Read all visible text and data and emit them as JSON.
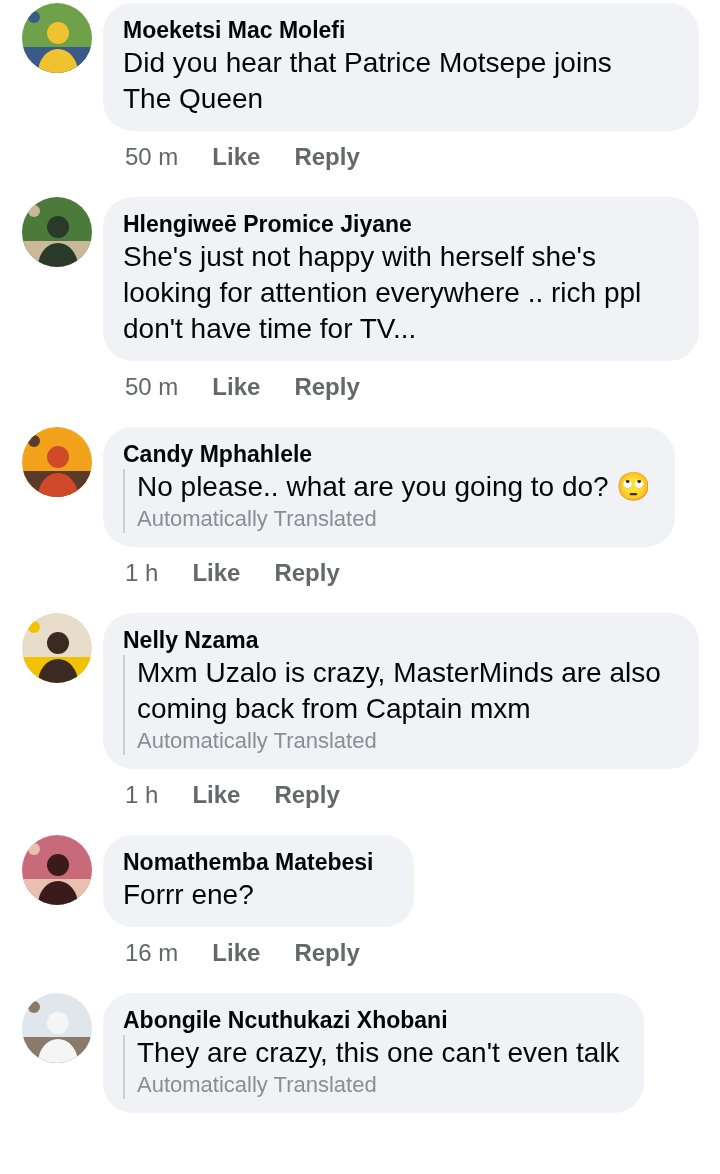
{
  "comments": [
    {
      "author": "Moeketsi Mac Molefi",
      "text": "Did you hear that Patrice Motsepe joins The Queen",
      "translated": false,
      "time": "50 m",
      "like": "Like",
      "reply": "Reply"
    },
    {
      "author": "Hlengiweē Promice Jiyane",
      "text": "She's just not happy with herself she's looking for attention everywhere .. rich ppl don't have time for TV...",
      "translated": false,
      "time": "50 m",
      "like": "Like",
      "reply": "Reply"
    },
    {
      "author": "Candy Mphahlele",
      "text": "No please.. what are you going to do? 🙄",
      "translated": true,
      "translation_note": "Automatically Translated",
      "time": "1 h",
      "like": "Like",
      "reply": "Reply"
    },
    {
      "author": "Nelly Nzama",
      "text": "Mxm Uzalo is crazy, MasterMinds are also coming back from Captain mxm",
      "translated": true,
      "translation_note": "Automatically Translated",
      "time": "1 h",
      "like": "Like",
      "reply": "Reply"
    },
    {
      "author": "Nomathemba Matebesi",
      "text": "Forrr ene?",
      "translated": false,
      "time": "16 m",
      "like": "Like",
      "reply": "Reply"
    },
    {
      "author": "Abongile Ncuthukazi Xhobani",
      "text": "They are crazy, this one can't even talk",
      "translated": true,
      "translation_note": "Automatically Translated"
    }
  ]
}
